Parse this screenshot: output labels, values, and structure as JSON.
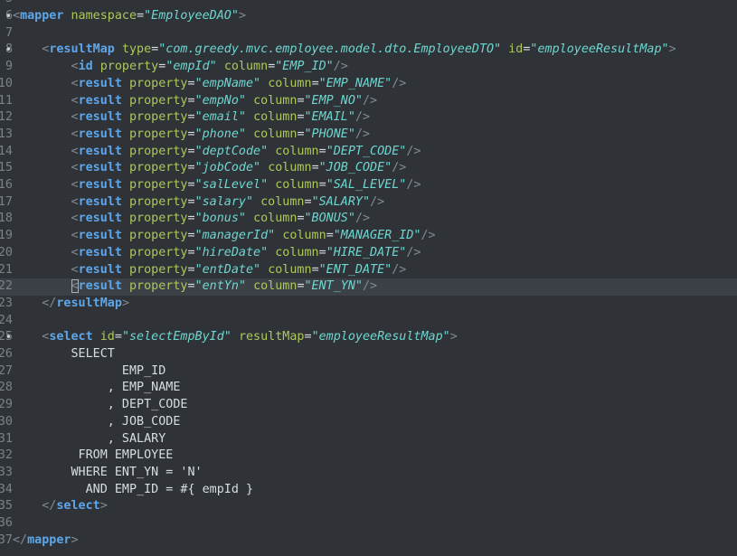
{
  "editor": {
    "language": "xml",
    "current_line": 17,
    "colors": {
      "background": "#2f3337",
      "current_line": "#3b4147",
      "tag": "#5ea6ea",
      "attribute": "#aec75b",
      "string": "#6fd5d0",
      "bracket": "#808a93",
      "text": "#d8dde2",
      "line_number": "#7a8288"
    },
    "lines": [
      {
        "num": "5",
        "fold": "",
        "tokens": []
      },
      {
        "num": "6",
        "fold": "•",
        "tokens": [
          {
            "t": "bracket",
            "v": "<"
          },
          {
            "t": "tag",
            "v": "mapper"
          },
          {
            "t": "text",
            "v": " "
          },
          {
            "t": "attr",
            "v": "namespace"
          },
          {
            "t": "eq",
            "v": "="
          },
          {
            "t": "str",
            "v": "\"EmployeeDAO\""
          },
          {
            "t": "bracket",
            "v": ">"
          }
        ]
      },
      {
        "num": "7",
        "fold": "",
        "tokens": []
      },
      {
        "num": "8",
        "fold": "•",
        "tokens": [
          {
            "t": "text",
            "v": "    "
          },
          {
            "t": "bracket",
            "v": "<"
          },
          {
            "t": "tag",
            "v": "resultMap"
          },
          {
            "t": "text",
            "v": " "
          },
          {
            "t": "attr",
            "v": "type"
          },
          {
            "t": "eq",
            "v": "="
          },
          {
            "t": "str",
            "v": "\"com.greedy.mvc.employee.model.dto.EmployeeDTO\""
          },
          {
            "t": "text",
            "v": " "
          },
          {
            "t": "attr",
            "v": "id"
          },
          {
            "t": "eq",
            "v": "="
          },
          {
            "t": "str",
            "v": "\"employeeResultMap\""
          },
          {
            "t": "bracket",
            "v": ">"
          }
        ]
      },
      {
        "num": "9",
        "fold": "",
        "tokens": [
          {
            "t": "text",
            "v": "        "
          },
          {
            "t": "bracket",
            "v": "<"
          },
          {
            "t": "tag",
            "v": "id"
          },
          {
            "t": "text",
            "v": " "
          },
          {
            "t": "attr",
            "v": "property"
          },
          {
            "t": "eq",
            "v": "="
          },
          {
            "t": "str",
            "v": "\"empId\""
          },
          {
            "t": "text",
            "v": " "
          },
          {
            "t": "attr",
            "v": "column"
          },
          {
            "t": "eq",
            "v": "="
          },
          {
            "t": "str",
            "v": "\"EMP_ID\""
          },
          {
            "t": "bracket",
            "v": "/>"
          }
        ]
      },
      {
        "num": "10",
        "fold": "",
        "tokens": [
          {
            "t": "text",
            "v": "        "
          },
          {
            "t": "bracket",
            "v": "<"
          },
          {
            "t": "tag",
            "v": "result"
          },
          {
            "t": "text",
            "v": " "
          },
          {
            "t": "attr",
            "v": "property"
          },
          {
            "t": "eq",
            "v": "="
          },
          {
            "t": "str",
            "v": "\"empName\""
          },
          {
            "t": "text",
            "v": " "
          },
          {
            "t": "attr",
            "v": "column"
          },
          {
            "t": "eq",
            "v": "="
          },
          {
            "t": "str",
            "v": "\"EMP_NAME\""
          },
          {
            "t": "bracket",
            "v": "/>"
          }
        ]
      },
      {
        "num": "11",
        "fold": "",
        "tokens": [
          {
            "t": "text",
            "v": "        "
          },
          {
            "t": "bracket",
            "v": "<"
          },
          {
            "t": "tag",
            "v": "result"
          },
          {
            "t": "text",
            "v": " "
          },
          {
            "t": "attr",
            "v": "property"
          },
          {
            "t": "eq",
            "v": "="
          },
          {
            "t": "str",
            "v": "\"empNo\""
          },
          {
            "t": "text",
            "v": " "
          },
          {
            "t": "attr",
            "v": "column"
          },
          {
            "t": "eq",
            "v": "="
          },
          {
            "t": "str",
            "v": "\"EMP_NO\""
          },
          {
            "t": "bracket",
            "v": "/>"
          }
        ]
      },
      {
        "num": "12",
        "fold": "",
        "tokens": [
          {
            "t": "text",
            "v": "        "
          },
          {
            "t": "bracket",
            "v": "<"
          },
          {
            "t": "tag",
            "v": "result"
          },
          {
            "t": "text",
            "v": " "
          },
          {
            "t": "attr",
            "v": "property"
          },
          {
            "t": "eq",
            "v": "="
          },
          {
            "t": "str",
            "v": "\"email\""
          },
          {
            "t": "text",
            "v": " "
          },
          {
            "t": "attr",
            "v": "column"
          },
          {
            "t": "eq",
            "v": "="
          },
          {
            "t": "str",
            "v": "\"EMAIL\""
          },
          {
            "t": "bracket",
            "v": "/>"
          }
        ]
      },
      {
        "num": "13",
        "fold": "",
        "tokens": [
          {
            "t": "text",
            "v": "        "
          },
          {
            "t": "bracket",
            "v": "<"
          },
          {
            "t": "tag",
            "v": "result"
          },
          {
            "t": "text",
            "v": " "
          },
          {
            "t": "attr",
            "v": "property"
          },
          {
            "t": "eq",
            "v": "="
          },
          {
            "t": "str",
            "v": "\"phone\""
          },
          {
            "t": "text",
            "v": " "
          },
          {
            "t": "attr",
            "v": "column"
          },
          {
            "t": "eq",
            "v": "="
          },
          {
            "t": "str",
            "v": "\"PHONE\""
          },
          {
            "t": "bracket",
            "v": "/>"
          }
        ]
      },
      {
        "num": "14",
        "fold": "",
        "tokens": [
          {
            "t": "text",
            "v": "        "
          },
          {
            "t": "bracket",
            "v": "<"
          },
          {
            "t": "tag",
            "v": "result"
          },
          {
            "t": "text",
            "v": " "
          },
          {
            "t": "attr",
            "v": "property"
          },
          {
            "t": "eq",
            "v": "="
          },
          {
            "t": "str",
            "v": "\"deptCode\""
          },
          {
            "t": "text",
            "v": " "
          },
          {
            "t": "attr",
            "v": "column"
          },
          {
            "t": "eq",
            "v": "="
          },
          {
            "t": "str",
            "v": "\"DEPT_CODE\""
          },
          {
            "t": "bracket",
            "v": "/>"
          }
        ]
      },
      {
        "num": "15",
        "fold": "",
        "tokens": [
          {
            "t": "text",
            "v": "        "
          },
          {
            "t": "bracket",
            "v": "<"
          },
          {
            "t": "tag",
            "v": "result"
          },
          {
            "t": "text",
            "v": " "
          },
          {
            "t": "attr",
            "v": "property"
          },
          {
            "t": "eq",
            "v": "="
          },
          {
            "t": "str",
            "v": "\"jobCode\""
          },
          {
            "t": "text",
            "v": " "
          },
          {
            "t": "attr",
            "v": "column"
          },
          {
            "t": "eq",
            "v": "="
          },
          {
            "t": "str",
            "v": "\"JOB_CODE\""
          },
          {
            "t": "bracket",
            "v": "/>"
          }
        ]
      },
      {
        "num": "16",
        "fold": "",
        "tokens": [
          {
            "t": "text",
            "v": "        "
          },
          {
            "t": "bracket",
            "v": "<"
          },
          {
            "t": "tag",
            "v": "result"
          },
          {
            "t": "text",
            "v": " "
          },
          {
            "t": "attr",
            "v": "property"
          },
          {
            "t": "eq",
            "v": "="
          },
          {
            "t": "str",
            "v": "\"salLevel\""
          },
          {
            "t": "text",
            "v": " "
          },
          {
            "t": "attr",
            "v": "column"
          },
          {
            "t": "eq",
            "v": "="
          },
          {
            "t": "str",
            "v": "\"SAL_LEVEL\""
          },
          {
            "t": "bracket",
            "v": "/>"
          }
        ]
      },
      {
        "num": "17",
        "fold": "",
        "tokens": [
          {
            "t": "text",
            "v": "        "
          },
          {
            "t": "bracket",
            "v": "<"
          },
          {
            "t": "tag",
            "v": "result"
          },
          {
            "t": "text",
            "v": " "
          },
          {
            "t": "attr",
            "v": "property"
          },
          {
            "t": "eq",
            "v": "="
          },
          {
            "t": "str",
            "v": "\"salary\""
          },
          {
            "t": "text",
            "v": " "
          },
          {
            "t": "attr",
            "v": "column"
          },
          {
            "t": "eq",
            "v": "="
          },
          {
            "t": "str",
            "v": "\"SALARY\""
          },
          {
            "t": "bracket",
            "v": "/>"
          }
        ]
      },
      {
        "num": "18",
        "fold": "",
        "tokens": [
          {
            "t": "text",
            "v": "        "
          },
          {
            "t": "bracket",
            "v": "<"
          },
          {
            "t": "tag",
            "v": "result"
          },
          {
            "t": "text",
            "v": " "
          },
          {
            "t": "attr",
            "v": "property"
          },
          {
            "t": "eq",
            "v": "="
          },
          {
            "t": "str",
            "v": "\"bonus\""
          },
          {
            "t": "text",
            "v": " "
          },
          {
            "t": "attr",
            "v": "column"
          },
          {
            "t": "eq",
            "v": "="
          },
          {
            "t": "str",
            "v": "\"BONUS\""
          },
          {
            "t": "bracket",
            "v": "/>"
          }
        ]
      },
      {
        "num": "19",
        "fold": "",
        "tokens": [
          {
            "t": "text",
            "v": "        "
          },
          {
            "t": "bracket",
            "v": "<"
          },
          {
            "t": "tag",
            "v": "result"
          },
          {
            "t": "text",
            "v": " "
          },
          {
            "t": "attr",
            "v": "property"
          },
          {
            "t": "eq",
            "v": "="
          },
          {
            "t": "str",
            "v": "\"managerId\""
          },
          {
            "t": "text",
            "v": " "
          },
          {
            "t": "attr",
            "v": "column"
          },
          {
            "t": "eq",
            "v": "="
          },
          {
            "t": "str",
            "v": "\"MANAGER_ID\""
          },
          {
            "t": "bracket",
            "v": "/>"
          }
        ]
      },
      {
        "num": "20",
        "fold": "",
        "tokens": [
          {
            "t": "text",
            "v": "        "
          },
          {
            "t": "bracket",
            "v": "<"
          },
          {
            "t": "tag",
            "v": "result"
          },
          {
            "t": "text",
            "v": " "
          },
          {
            "t": "attr",
            "v": "property"
          },
          {
            "t": "eq",
            "v": "="
          },
          {
            "t": "str",
            "v": "\"hireDate\""
          },
          {
            "t": "text",
            "v": " "
          },
          {
            "t": "attr",
            "v": "column"
          },
          {
            "t": "eq",
            "v": "="
          },
          {
            "t": "str",
            "v": "\"HIRE_DATE\""
          },
          {
            "t": "bracket",
            "v": "/>"
          }
        ]
      },
      {
        "num": "21",
        "fold": "",
        "tokens": [
          {
            "t": "text",
            "v": "        "
          },
          {
            "t": "bracket",
            "v": "<"
          },
          {
            "t": "tag",
            "v": "result"
          },
          {
            "t": "text",
            "v": " "
          },
          {
            "t": "attr",
            "v": "property"
          },
          {
            "t": "eq",
            "v": "="
          },
          {
            "t": "str",
            "v": "\"entDate\""
          },
          {
            "t": "text",
            "v": " "
          },
          {
            "t": "attr",
            "v": "column"
          },
          {
            "t": "eq",
            "v": "="
          },
          {
            "t": "str",
            "v": "\"ENT_DATE\""
          },
          {
            "t": "bracket",
            "v": "/>"
          }
        ]
      },
      {
        "num": "22",
        "fold": "",
        "tokens": [
          {
            "t": "text",
            "v": "        "
          },
          {
            "t": "bracket",
            "v": "<",
            "caret": true
          },
          {
            "t": "tag",
            "v": "result"
          },
          {
            "t": "text",
            "v": " "
          },
          {
            "t": "attr",
            "v": "property"
          },
          {
            "t": "eq",
            "v": "="
          },
          {
            "t": "str",
            "v": "\"entYn\""
          },
          {
            "t": "text",
            "v": " "
          },
          {
            "t": "attr",
            "v": "column"
          },
          {
            "t": "eq",
            "v": "="
          },
          {
            "t": "str",
            "v": "\"ENT_YN\""
          },
          {
            "t": "bracket",
            "v": "/>"
          }
        ]
      },
      {
        "num": "23",
        "fold": "",
        "tokens": [
          {
            "t": "text",
            "v": "    "
          },
          {
            "t": "bracket",
            "v": "</"
          },
          {
            "t": "tag",
            "v": "resultMap"
          },
          {
            "t": "bracket",
            "v": ">"
          }
        ]
      },
      {
        "num": "24",
        "fold": "",
        "tokens": []
      },
      {
        "num": "25",
        "fold": "•",
        "tokens": [
          {
            "t": "text",
            "v": "    "
          },
          {
            "t": "bracket",
            "v": "<"
          },
          {
            "t": "tag",
            "v": "select"
          },
          {
            "t": "text",
            "v": " "
          },
          {
            "t": "attr",
            "v": "id"
          },
          {
            "t": "eq",
            "v": "="
          },
          {
            "t": "str",
            "v": "\"selectEmpById\""
          },
          {
            "t": "text",
            "v": " "
          },
          {
            "t": "attr",
            "v": "resultMap"
          },
          {
            "t": "eq",
            "v": "="
          },
          {
            "t": "str",
            "v": "\"employeeResultMap\""
          },
          {
            "t": "bracket",
            "v": ">"
          }
        ]
      },
      {
        "num": "26",
        "fold": "",
        "tokens": [
          {
            "t": "text",
            "v": "        SELECT"
          }
        ]
      },
      {
        "num": "27",
        "fold": "",
        "tokens": [
          {
            "t": "text",
            "v": "               EMP_ID"
          }
        ]
      },
      {
        "num": "28",
        "fold": "",
        "tokens": [
          {
            "t": "text",
            "v": "             , EMP_NAME"
          }
        ]
      },
      {
        "num": "29",
        "fold": "",
        "tokens": [
          {
            "t": "text",
            "v": "             , DEPT_CODE"
          }
        ]
      },
      {
        "num": "30",
        "fold": "",
        "tokens": [
          {
            "t": "text",
            "v": "             , JOB_CODE"
          }
        ]
      },
      {
        "num": "31",
        "fold": "",
        "tokens": [
          {
            "t": "text",
            "v": "             , SALARY"
          }
        ]
      },
      {
        "num": "32",
        "fold": "",
        "tokens": [
          {
            "t": "text",
            "v": "         FROM EMPLOYEE"
          }
        ]
      },
      {
        "num": "33",
        "fold": "",
        "tokens": [
          {
            "t": "text",
            "v": "        WHERE ENT_YN = 'N'"
          }
        ]
      },
      {
        "num": "34",
        "fold": "",
        "tokens": [
          {
            "t": "text",
            "v": "          AND EMP_ID = #{ empId }"
          }
        ]
      },
      {
        "num": "35",
        "fold": "",
        "tokens": [
          {
            "t": "text",
            "v": "    "
          },
          {
            "t": "bracket",
            "v": "</"
          },
          {
            "t": "tag",
            "v": "select"
          },
          {
            "t": "bracket",
            "v": ">"
          }
        ]
      },
      {
        "num": "36",
        "fold": "",
        "tokens": []
      },
      {
        "num": "37",
        "fold": "",
        "tokens": [
          {
            "t": "bracket",
            "v": "</"
          },
          {
            "t": "tag",
            "v": "mapper"
          },
          {
            "t": "bracket",
            "v": ">"
          }
        ]
      }
    ]
  }
}
